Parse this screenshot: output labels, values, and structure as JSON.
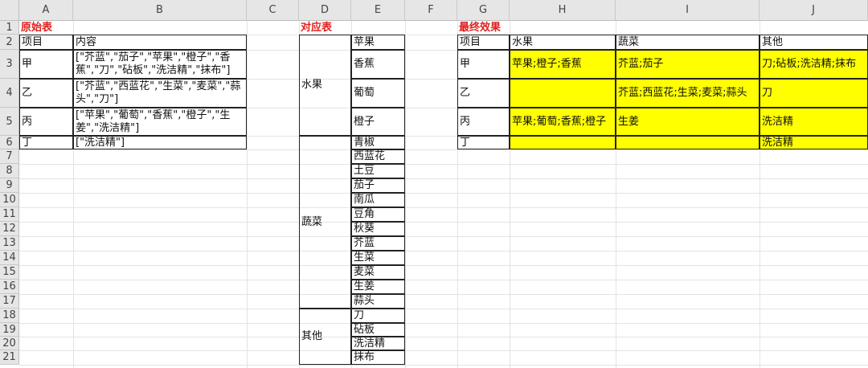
{
  "columns": [
    "A",
    "B",
    "C",
    "D",
    "E",
    "F",
    "G",
    "H",
    "I",
    "J"
  ],
  "rows": [
    "1",
    "2",
    "3",
    "4",
    "5",
    "6",
    "7",
    "8",
    "9",
    "10",
    "11",
    "12",
    "13",
    "14",
    "15",
    "16",
    "17",
    "18",
    "19",
    "20",
    "21"
  ],
  "table1": {
    "title": "原始表",
    "header": [
      "项目",
      "内容"
    ],
    "rows": [
      {
        "item": "甲",
        "content": "[\"芥蓝\",\"茄子\",\"苹果\",\"橙子\",\"香蕉\",\"刀\",\"砧板\",\"洗洁精\",\"抹布\"]"
      },
      {
        "item": "乙",
        "content": "[\"芥蓝\",\"西蓝花\",\"生菜\",\"麦菜\",\"蒜头\",\"刀\"]"
      },
      {
        "item": "丙",
        "content": "[\"苹果\",\"葡萄\",\"香蕉\",\"橙子\",\"生姜\",\"洗洁精\"]"
      },
      {
        "item": "丁",
        "content": "[\"洗洁精\"]"
      }
    ]
  },
  "table2": {
    "title": "对应表",
    "groups": [
      {
        "category": "水果",
        "items": [
          "苹果",
          "香蕉",
          "葡萄",
          "橙子"
        ]
      },
      {
        "category": "蔬菜",
        "items": [
          "青椒",
          "西蓝花",
          "土豆",
          "茄子",
          "南瓜",
          "豆角",
          "秋葵",
          "芥蓝",
          "生菜",
          "麦菜",
          "生姜",
          "蒜头"
        ]
      },
      {
        "category": "其他",
        "items": [
          "刀",
          "砧板",
          "洗洁精",
          "抹布"
        ]
      }
    ]
  },
  "table3": {
    "title": "最终效果",
    "header": [
      "项目",
      "水果",
      "蔬菜",
      "其他"
    ],
    "rows": [
      {
        "item": "甲",
        "fruit": "苹果;橙子;香蕉",
        "veg": "芥蓝;茄子",
        "other": "刀;砧板;洗洁精;抹布"
      },
      {
        "item": "乙",
        "fruit": "",
        "veg": "芥蓝;西蓝花;生菜;麦菜;蒜头",
        "other": "刀"
      },
      {
        "item": "丙",
        "fruit": "苹果;葡萄;香蕉;橙子",
        "veg": "生姜",
        "other": "洗洁精"
      },
      {
        "item": "丁",
        "fruit": "",
        "veg": "",
        "other": "洗洁精"
      }
    ]
  },
  "colors": {
    "title": "#e0201e",
    "highlight": "#ffff00",
    "header_bg": "#e6e6e6"
  }
}
